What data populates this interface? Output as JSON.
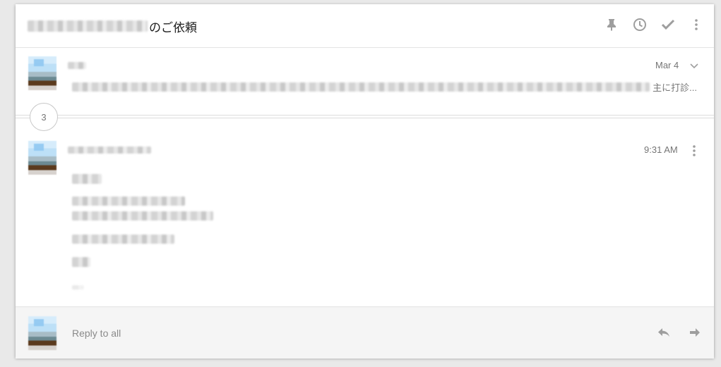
{
  "thread": {
    "subject_suffix": "のご依頼",
    "message_count": "3"
  },
  "header_icons": [
    "pin-icon",
    "clock-icon",
    "check-icon",
    "more-vert-icon"
  ],
  "messages": [
    {
      "date": "Mar 4",
      "snippet_tail": "主に打診..."
    },
    {
      "time": "9:31 AM"
    }
  ],
  "reply": {
    "placeholder": "Reply to all",
    "icons": [
      "reply-icon",
      "forward-icon"
    ]
  },
  "colors": {
    "background": "#e9e9e9",
    "card": "#ffffff",
    "reply_bar": "#f5f5f5",
    "icon_gray": "#9e9e9e"
  }
}
